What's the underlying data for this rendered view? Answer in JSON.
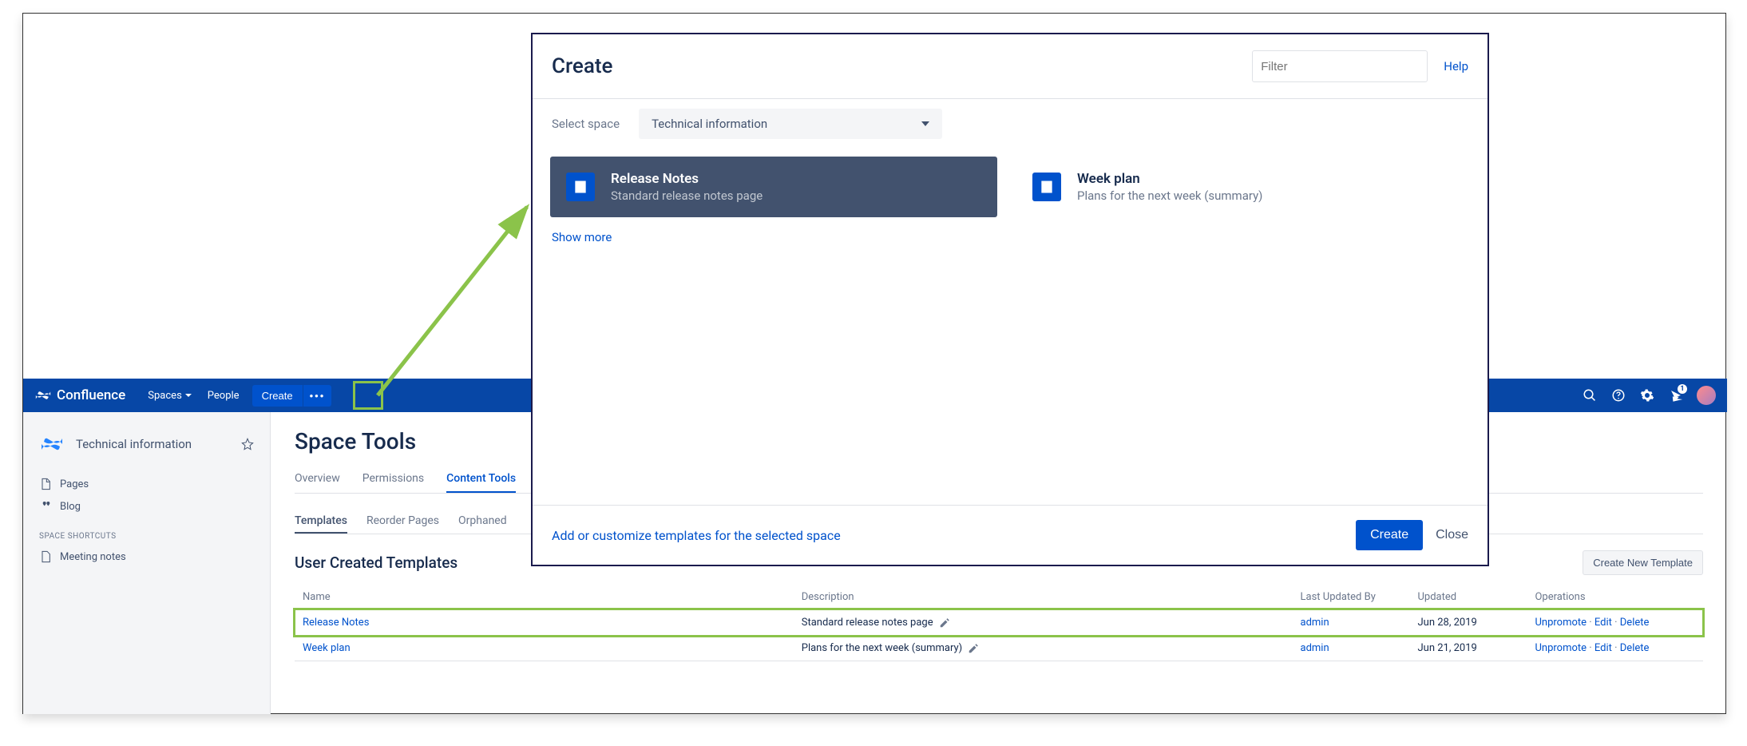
{
  "modal": {
    "title": "Create",
    "filter_placeholder": "Filter",
    "help": "Help",
    "select_space_label": "Select space",
    "selected_space": "Technical information",
    "templates": [
      {
        "title": "Release Notes",
        "desc": "Standard release notes page",
        "selected": true
      },
      {
        "title": "Week plan",
        "desc": "Plans for the next week (summary)",
        "selected": false
      }
    ],
    "show_more": "Show more",
    "footer_link": "Add or customize templates for the selected space",
    "create_btn": "Create",
    "close_btn": "Close"
  },
  "topnav": {
    "brand": "Confluence",
    "items": [
      "Spaces",
      "People"
    ],
    "create": "Create",
    "more": "•••",
    "notif_count": "1"
  },
  "sidebar": {
    "space_name": "Technical information",
    "items": [
      {
        "icon": "pages",
        "label": "Pages"
      },
      {
        "icon": "blog",
        "label": "Blog"
      }
    ],
    "shortcuts_label": "SPACE SHORTCUTS",
    "shortcuts": [
      {
        "icon": "doc",
        "label": "Meeting notes"
      }
    ]
  },
  "main": {
    "title": "Space Tools",
    "tabs": [
      "Overview",
      "Permissions",
      "Content Tools"
    ],
    "active_tab": 2,
    "subtabs": [
      "Templates",
      "Reorder Pages",
      "Orphaned"
    ],
    "active_subtab": 0,
    "section_title": "User Created Templates",
    "create_template_btn": "Create New Template",
    "columns": [
      "Name",
      "Description",
      "Last Updated By",
      "Updated",
      "Operations"
    ],
    "rows": [
      {
        "name": "Release Notes",
        "desc": "Standard release notes page",
        "by": "admin",
        "updated": "Jun 28, 2019",
        "ops": [
          "Unpromote",
          "Edit",
          "Delete"
        ],
        "highlight": true
      },
      {
        "name": "Week plan",
        "desc": "Plans for the next week (summary)",
        "by": "admin",
        "updated": "Jun 21, 2019",
        "ops": [
          "Unpromote",
          "Edit",
          "Delete"
        ],
        "highlight": false
      }
    ]
  }
}
